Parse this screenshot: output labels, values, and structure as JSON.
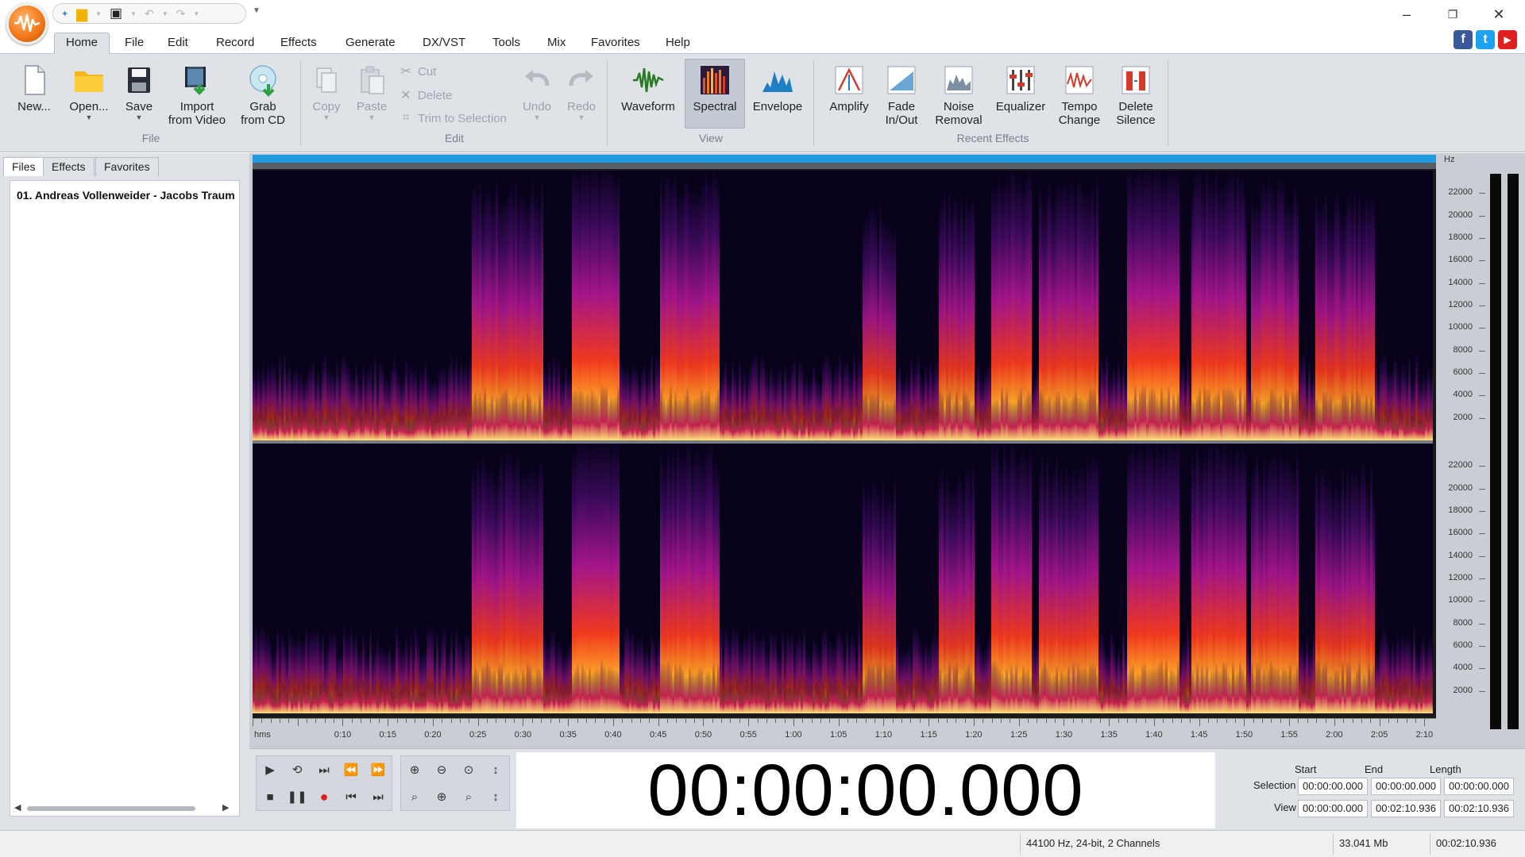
{
  "app": {
    "colors": {
      "accent": "#f27a1a",
      "selection_bar": "#1e9be0",
      "ribbon_bg": "#dfe3e8"
    }
  },
  "menu": {
    "tabs": [
      "Home",
      "File",
      "Edit",
      "Record",
      "Effects",
      "Generate",
      "DX/VST",
      "Tools",
      "Mix",
      "Favorites",
      "Help"
    ],
    "active": "Home"
  },
  "social": {
    "facebook": "f",
    "twitter": "t",
    "youtube": "▶"
  },
  "ribbon": {
    "file_group": {
      "label": "File",
      "new": "New...",
      "open": "Open...",
      "save": "Save",
      "import_line1": "Import",
      "import_line2": "from Video",
      "grab_line1": "Grab",
      "grab_line2": "from CD"
    },
    "edit_group": {
      "label": "Edit",
      "copy": "Copy",
      "paste": "Paste",
      "cut": "Cut",
      "delete": "Delete",
      "trim": "Trim to Selection",
      "undo": "Undo",
      "redo": "Redo"
    },
    "view_group": {
      "label": "View",
      "waveform": "Waveform",
      "spectral": "Spectral",
      "envelope": "Envelope"
    },
    "effects_group": {
      "label": "Recent Effects",
      "amplify": "Amplify",
      "fade_line1": "Fade",
      "fade_line2": "In/Out",
      "noise_line1": "Noise",
      "noise_line2": "Removal",
      "equalizer": "Equalizer",
      "tempo_line1": "Tempo",
      "tempo_line2": "Change",
      "delsil_line1": "Delete",
      "delsil_line2": "Silence"
    }
  },
  "left_panel": {
    "tabs": [
      "Files",
      "Effects",
      "Favorites"
    ],
    "active": "Files",
    "files": [
      "01. Andreas Vollenweider - Jacobs Traum"
    ]
  },
  "spectrogram": {
    "frequency_unit": "Hz",
    "frequency_ticks": [
      "22000",
      "20000",
      "18000",
      "16000",
      "14000",
      "12000",
      "10000",
      "8000",
      "6000",
      "4000",
      "2000"
    ],
    "time_unit": "hms",
    "time_ticks": [
      "0:10",
      "0:15",
      "0:20",
      "0:25",
      "0:30",
      "0:35",
      "0:40",
      "0:45",
      "0:50",
      "0:55",
      "1:00",
      "1:05",
      "1:10",
      "1:15",
      "1:20",
      "1:25",
      "1:30",
      "1:35",
      "1:40",
      "1:45",
      "1:50",
      "1:55",
      "2:00",
      "2:05",
      "2:10"
    ]
  },
  "transport": {
    "current_time": "00:00:00.000"
  },
  "selection_panel": {
    "col_start": "Start",
    "col_end": "End",
    "col_length": "Length",
    "row_selection": "Selection",
    "row_view": "View",
    "selection_start": "00:00:00.000",
    "selection_end": "00:00:00.000",
    "selection_length": "00:00:00.000",
    "view_start": "00:00:00.000",
    "view_end": "00:02:10.936",
    "view_length": "00:02:10.936"
  },
  "status": {
    "format": "44100 Hz, 24-bit, 2 Channels",
    "size": "33.041 Mb",
    "duration": "00:02:10.936"
  }
}
